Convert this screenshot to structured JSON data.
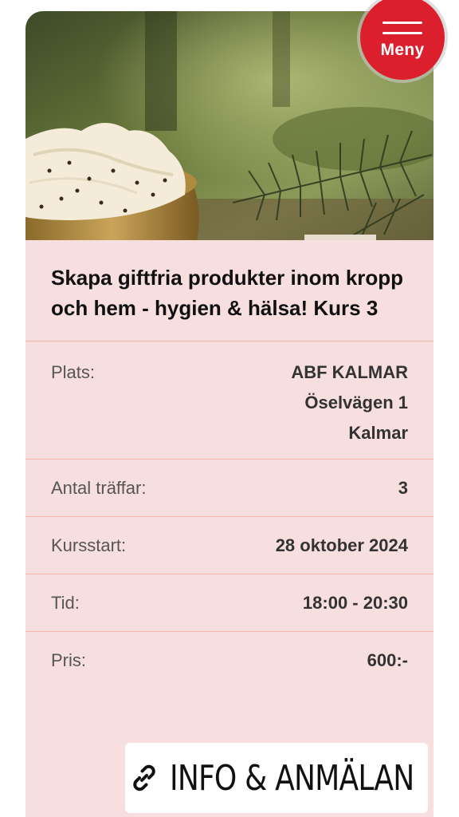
{
  "header": {
    "menu_label": "Meny"
  },
  "course": {
    "title": "Skapa giftfria produkter inom kropp och hem - hygien & hälsa! Kurs 3"
  },
  "details": {
    "place": {
      "label": "Plats:",
      "lines": [
        "ABF KALMAR",
        "Öselvägen 1",
        "Kalmar"
      ]
    },
    "sessions": {
      "label": "Antal träffar:",
      "value": "3"
    },
    "start": {
      "label": "Kursstart:",
      "value": "28 oktober 2024"
    },
    "time": {
      "label": "Tid:",
      "value": "18:00 - 20:30"
    },
    "price": {
      "label": "Pris:",
      "value": "600:-"
    }
  },
  "cta": {
    "label": "INFO & ANMÄLAN",
    "icon": "link-icon"
  },
  "colors": {
    "accent": "#dc1f2c",
    "card_bg": "#f7dfe0",
    "divider": "#f0b9aa"
  }
}
